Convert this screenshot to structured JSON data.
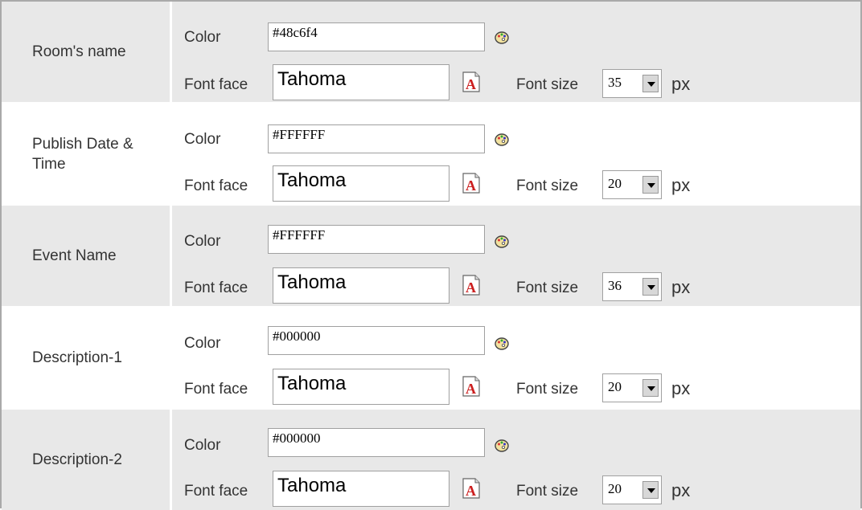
{
  "labels": {
    "color": "Color",
    "font_face": "Font face",
    "font_size": "Font size",
    "unit": "px"
  },
  "rows": [
    {
      "name": "Room's name",
      "color": "#48c6f4",
      "font_face": "Tahoma",
      "font_size": "35"
    },
    {
      "name_line1": "Publish Date &",
      "name_line2": "Time",
      "color": "#FFFFFF",
      "font_face": "Tahoma",
      "font_size": "20"
    },
    {
      "name": "Event Name",
      "color": "#FFFFFF",
      "font_face": "Tahoma",
      "font_size": "36"
    },
    {
      "name": "Description-1",
      "color": "#000000",
      "font_face": "Tahoma",
      "font_size": "20"
    },
    {
      "name": "Description-2",
      "color": "#000000",
      "font_face": "Tahoma",
      "font_size": "20"
    }
  ],
  "icons": {
    "color_picker": "palette-icon",
    "font_picker": "font-icon",
    "dropdown": "chevron-down-icon"
  },
  "colors": {
    "row_shade": "#e8e8e8",
    "row_plain": "#ffffff",
    "border": "#a9a9a9"
  }
}
